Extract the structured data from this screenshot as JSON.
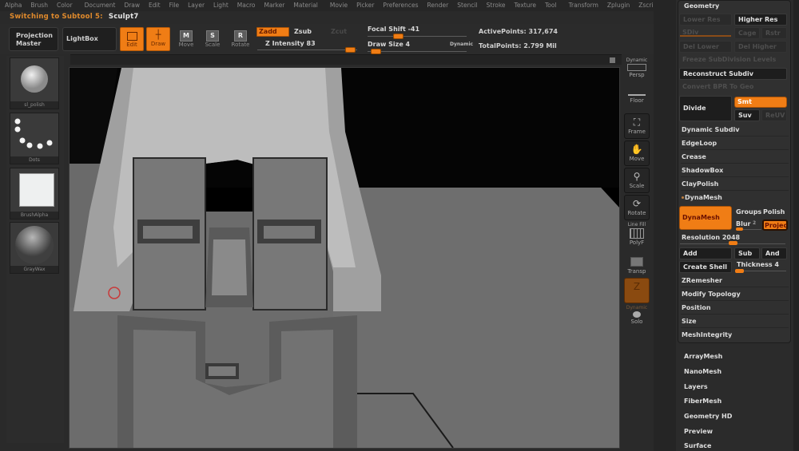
{
  "menu": [
    "Alpha",
    "Brush",
    "Color",
    "Document",
    "Draw",
    "Edit",
    "File",
    "Layer",
    "Light",
    "Macro",
    "Marker",
    "Material",
    "Movie",
    "Picker",
    "Preferences",
    "Render",
    "Stencil",
    "Stroke",
    "Texture",
    "Tool",
    "Transform",
    "Zplugin",
    "Zscript"
  ],
  "status": {
    "prefix": "Switching to Subtool 5:",
    "name": "Sculpt7"
  },
  "toolbar": {
    "projection_master": "Projection Master",
    "lightbox": "LightBox",
    "edit": "Edit",
    "draw": "Draw",
    "move": "Move",
    "scale": "Scale",
    "rotate": "Rotate",
    "move_key": "M",
    "scale_key": "S",
    "rotate_key": "R",
    "zadd": "Zadd",
    "zsub": "Zsub",
    "zcut": "Zcut",
    "z_intensity_label": "Z Intensity 83",
    "z_intensity": 83,
    "focal_shift_label": "Focal Shift -41",
    "focal_shift": -41,
    "draw_size_label": "Draw Size 4",
    "draw_size": 4,
    "dynamic": "Dynamic",
    "active_points": "ActivePoints: 317,674",
    "total_points": "TotalPoints: 2.799 Mil"
  },
  "left_panel": {
    "brush": "sl_polish",
    "stroke": "Dots",
    "alpha": "BrushAlpha",
    "material": "GrayWax"
  },
  "nav": {
    "persp": "Persp",
    "dynamic": "Dynamic",
    "floor": "Floor",
    "frame": "Frame",
    "move": "Move",
    "scale": "Scale",
    "rotate": "Rotate",
    "line_fill": "Line Fill",
    "polyf": "PolyF",
    "transp": "Transp",
    "dynamic2": "Dynamic",
    "solo": "Solo"
  },
  "geometry": {
    "title": "Geometry",
    "lower_res": "Lower Res",
    "higher_res": "Higher Res",
    "sdiv": "SDiv",
    "cage": "Cage",
    "rstr": "Rstr",
    "del_lower": "Del Lower",
    "del_higher": "Del Higher",
    "freeze": "Freeze SubDivision Levels",
    "reconstruct": "Reconstruct Subdiv",
    "convert": "Convert BPR To Geo",
    "divide": "Divide",
    "smt": "Smt",
    "suv": "Suv",
    "reuv": "ReUV",
    "rows": [
      "Dynamic Subdiv",
      "EdgeLoop",
      "Crease",
      "ShadowBox",
      "ClayPolish"
    ],
    "dynamesh_header": "DynaMesh",
    "dynamesh_btn": "DynaMesh",
    "groups": "Groups",
    "polish": "Polish",
    "blur": "Blur",
    "blur_value": 2,
    "project": "Projec",
    "resolution_label": "Resolution 2048",
    "resolution": 2048,
    "add": "Add",
    "sub": "Sub",
    "and": "And",
    "create_shell": "Create Shell",
    "thickness_label": "Thickness 4",
    "thickness": 4,
    "rows2": [
      "ZRemesher",
      "Modify Topology",
      "Position",
      "Size",
      "MeshIntegrity"
    ]
  },
  "tool_sections": [
    "ArrayMesh",
    "NanoMesh",
    "Layers",
    "FiberMesh",
    "Geometry HD",
    "Preview",
    "Surface"
  ],
  "colors": {
    "accent": "#f07d15",
    "status_prefix": "#e08a2c"
  }
}
